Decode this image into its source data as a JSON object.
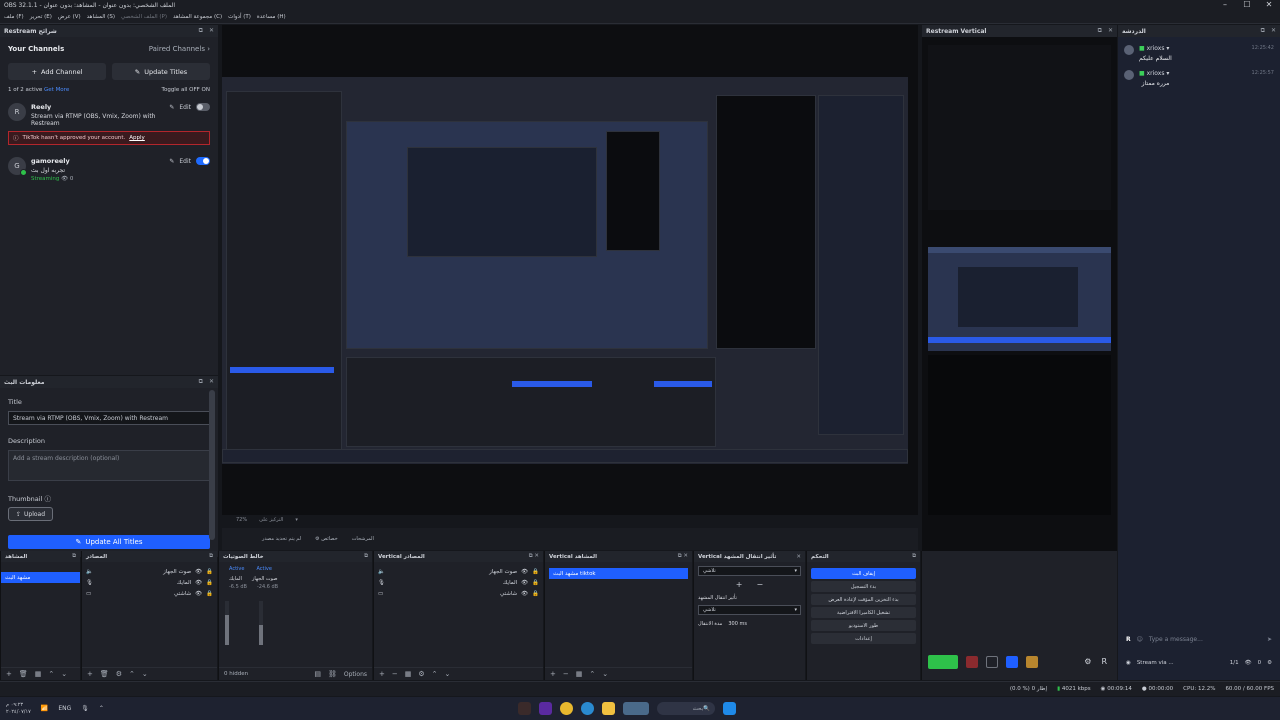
{
  "window": {
    "title": "OBS 32.1.1 - الملف الشخصي: بدون عنوان - المشاهد: بدون عنوان"
  },
  "menu": [
    "ملف (F)",
    "تحرير (E)",
    "عرض (V)",
    "المشاهد (S)",
    "الملف الشخصي (P)",
    "مجموعة المشاهد (C)",
    "أدوات (T)",
    "مساعدة (H)"
  ],
  "restream": {
    "panel_title": "Restream شرائح",
    "your_channels": "Your Channels",
    "paired_channels": "Paired Channels",
    "add_channel": "Add Channel",
    "update_titles": "Update Titles",
    "active_count": "1 of 2 active",
    "get_more": "Get More",
    "toggle_all": "Toggle all OFF   ON",
    "channels": [
      {
        "name": "Reely",
        "subtitle": "Stream via RTMP (OBS, Vmix, Zoom) with Restream",
        "edit": "Edit",
        "enabled": false
      },
      {
        "name": "gamoreely",
        "subtitle": "تجربه اول بث",
        "status": "Streaming",
        "viewers": "0",
        "edit": "Edit",
        "enabled": true
      }
    ],
    "alert": "TikTok hasn't approved your account.",
    "alert_link": "Apply"
  },
  "stream_info": {
    "panel_title": "معلومات البث",
    "title_label": "Title",
    "title_value": "Stream via RTMP (OBS, Vmix, Zoom) with Restream",
    "description_label": "Description",
    "description_placeholder": "Add a stream description (optional)",
    "thumbnail_label": "Thumbnail",
    "upload": "Upload",
    "update_all": "Update All Titles"
  },
  "vertical": {
    "panel_title": "Restream Vertical"
  },
  "chat": {
    "panel_title": "الدردشة",
    "messages": [
      {
        "user": "xrioxs",
        "text": "السلام عليكم",
        "time": "12:25:42"
      },
      {
        "user": "xrioxs",
        "text": "مرره ممتاز",
        "time": "12:25:57"
      }
    ],
    "input_placeholder": "Type a message...",
    "stream_label": "Stream via ...",
    "page": "1/1",
    "viewers": "0"
  },
  "docks": {
    "scenes": {
      "title": "المشاهد",
      "items": [
        "مشهد البث"
      ]
    },
    "sources": {
      "title": "المصادر",
      "items": [
        "صوت الجهاز",
        "المايك",
        "شاشتي"
      ]
    },
    "mixer": {
      "title": "خالط الصوتيات",
      "ch1": "المايك",
      "ch2": "صوت الجهاز",
      "active": "Active",
      "db1": "-6.5 dB",
      "db2": "-24.6 dB",
      "hidden": "0 hidden",
      "options": "Options"
    },
    "vsources": {
      "title": "Vertical المصادر",
      "items": [
        "صوت الجهاز",
        "المايك",
        "شاشتي"
      ]
    },
    "vscenes": {
      "title": "Vertical المشاهد",
      "item": "مشهد البث tiktok"
    },
    "vtransitions": {
      "title": "Vertical تأثير انتقال المشهد",
      "value1": "تلاشي",
      "sub": "تأثير انتقال المشهد",
      "value2": "تلاشي",
      "duration_label": "مدة الانتقال",
      "duration": "300 ms"
    },
    "controls": {
      "title": "التحكم",
      "buttons": [
        "إيقاف البث",
        "بدء التسجيل",
        "بدء التخزين المؤقت لإعادة العرض",
        "تشغيل الكاميرا الافتراضية",
        "طور الاستوديو",
        "إعدادات"
      ]
    }
  },
  "preview_toolbar": {
    "zoom": "72%",
    "mode": "التركيز على",
    "streams_label": "لم يتم تحديد مصدر",
    "props": "خصائص",
    "filters": "المرشحات"
  },
  "status": {
    "frames": "(0.0 %) 0 إطار",
    "bitrate": "4021 kbps",
    "live_time": "00:09:14",
    "rec_time": "00:00:00",
    "cpu": "CPU: 12.2%",
    "fps": "60.00 / 60.00 FPS"
  },
  "taskbar": {
    "time": "٠٩:٢٣ م",
    "date": "٢٠٢٤/٠٧/١٧",
    "lang": "ENG",
    "search": "بحث"
  }
}
